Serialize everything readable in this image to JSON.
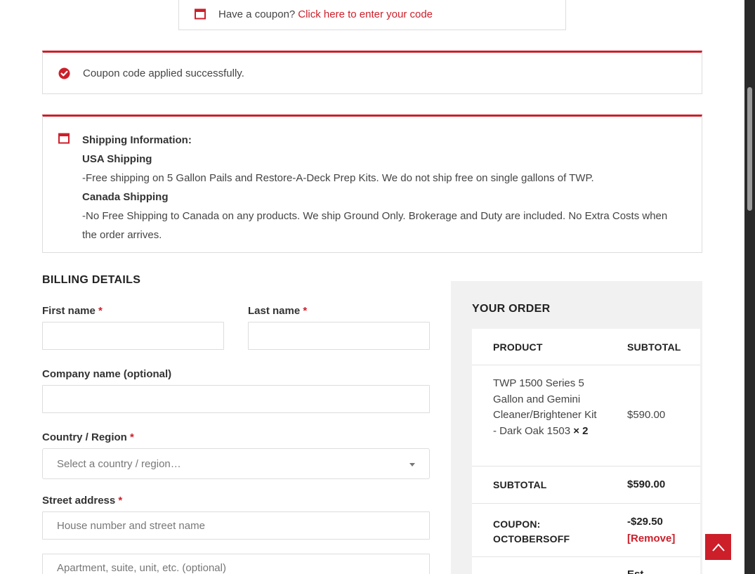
{
  "coupon_toggle": {
    "prompt": "Have a coupon?",
    "link": "Click here to enter your code"
  },
  "success_notice": {
    "message": "Coupon code applied successfully."
  },
  "shipping_info": {
    "title": "Shipping Information:",
    "usa_heading": "USA Shipping",
    "usa_text": "-Free shipping on 5 Gallon Pails and Restore-A-Deck Prep Kits. We do not ship free on single gallons of TWP.",
    "canada_heading": "Canada Shipping",
    "canada_text": "-No Free Shipping to Canada on any products. We ship Ground Only. Brokerage and Duty are included. No Extra Costs when the order arrives."
  },
  "billing": {
    "title": "BILLING DETAILS",
    "required_mark": "*",
    "first_name_label": "First name",
    "last_name_label": "Last name",
    "company_label": "Company name (optional)",
    "country_label": "Country / Region",
    "country_placeholder": "Select a country / region…",
    "street_label": "Street address",
    "street_placeholder": "House number and street name",
    "apartment_placeholder": "Apartment, suite, unit, etc. (optional)"
  },
  "order": {
    "title": "YOUR ORDER",
    "col_product": "PRODUCT",
    "col_subtotal": "SUBTOTAL",
    "item": {
      "name": "TWP 1500 Series 5 Gallon and Gemini Cleaner/Brightener Kit - Dark Oak 1503",
      "qty": "× 2",
      "price": "$590.00"
    },
    "subtotal_label": "SUBTOTAL",
    "subtotal_value": "$590.00",
    "coupon_label": "COUPON: OCTOBERSOFF",
    "coupon_value": "-$29.50",
    "remove_label": "[Remove]",
    "next_row_partial": "Est"
  },
  "colors": {
    "accent": "#cc1f2a",
    "border": "#dddddd",
    "panel_bg": "#f1f1f1"
  },
  "icons": {
    "coupon": "calendar-icon",
    "success": "check-circle-icon",
    "info": "calendar-icon",
    "back_to_top": "chevron-up-icon"
  }
}
